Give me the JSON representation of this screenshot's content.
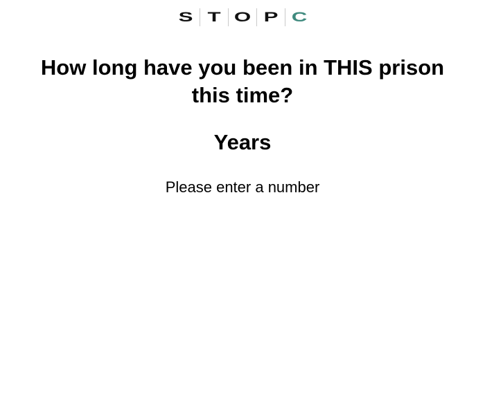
{
  "logo": {
    "letters": [
      "S",
      "T",
      "O",
      "P",
      "C"
    ],
    "accent_color": "#3f8a7e",
    "text_color": "#111111"
  },
  "question": {
    "text": "How long have you been in THIS prison this time?"
  },
  "unit": {
    "label": "Years"
  },
  "prompt": {
    "text": "Please enter a number"
  }
}
